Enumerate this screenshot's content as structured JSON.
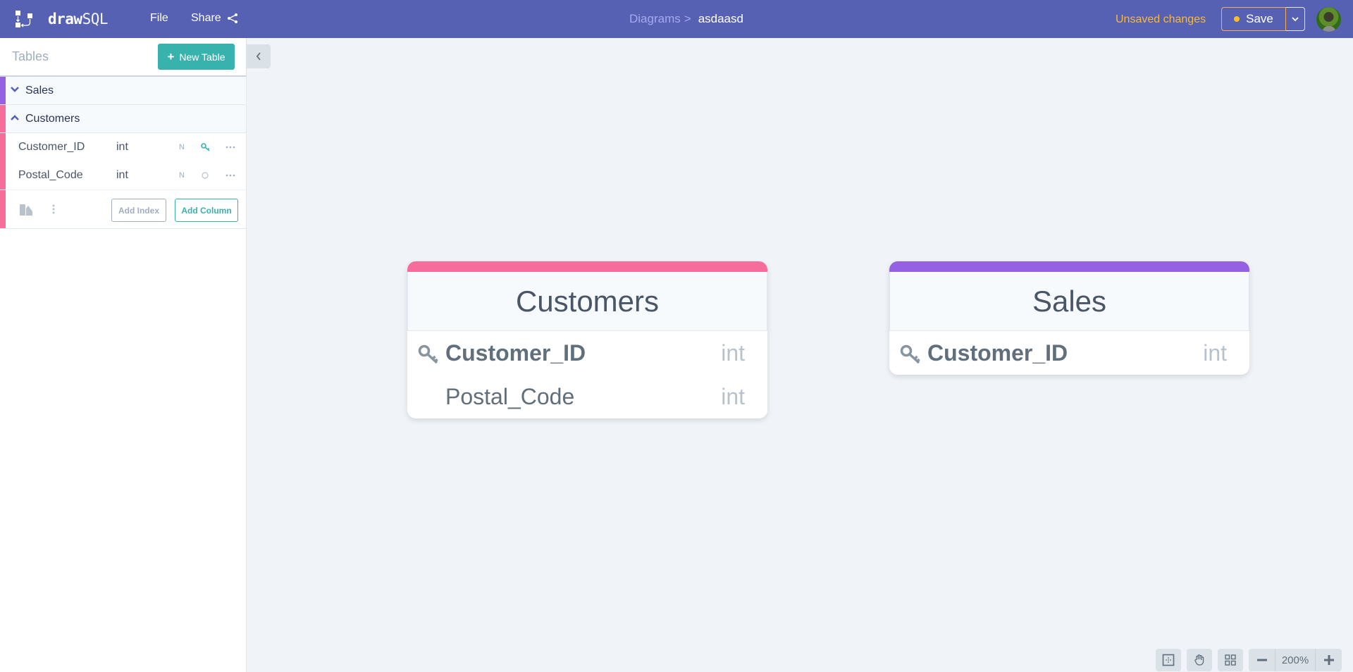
{
  "header": {
    "brand_bold": "draw",
    "brand_light": "SQL",
    "menu": {
      "file": "File",
      "share": "Share"
    },
    "breadcrumb": {
      "root": "Diagrams",
      "separator": ">",
      "current": "asdaasd"
    },
    "status": "Unsaved changes",
    "save_label": "Save"
  },
  "sidebar": {
    "title": "Tables",
    "new_table_label": "New Table",
    "tables": [
      {
        "name": "Sales",
        "color": "#9561e2",
        "expanded": false
      },
      {
        "name": "Customers",
        "color": "#f66d9b",
        "expanded": true,
        "columns": [
          {
            "name": "Customer_ID",
            "type": "int",
            "nullable_label": "N",
            "primary_key": true
          },
          {
            "name": "Postal_Code",
            "type": "int",
            "nullable_label": "N",
            "primary_key": false
          }
        ],
        "add_index_label": "Add Index",
        "add_column_label": "Add Column"
      }
    ]
  },
  "canvas": {
    "tables": [
      {
        "name": "Customers",
        "color": "#f66d9b",
        "fields": [
          {
            "name": "Customer_ID",
            "type": "int",
            "primary_key": true
          },
          {
            "name": "Postal_Code",
            "type": "int",
            "primary_key": false
          }
        ]
      },
      {
        "name": "Sales",
        "color": "#9561e2",
        "fields": [
          {
            "name": "Customer_ID",
            "type": "int",
            "primary_key": true
          }
        ]
      }
    ]
  },
  "toolbar": {
    "zoom_level": "200%",
    "zoom_out_label": "−",
    "zoom_in_label": "+"
  },
  "colors": {
    "header_bg": "#5661b3",
    "accent_teal": "#38b2ac",
    "unsaved": "#f6b93b"
  }
}
